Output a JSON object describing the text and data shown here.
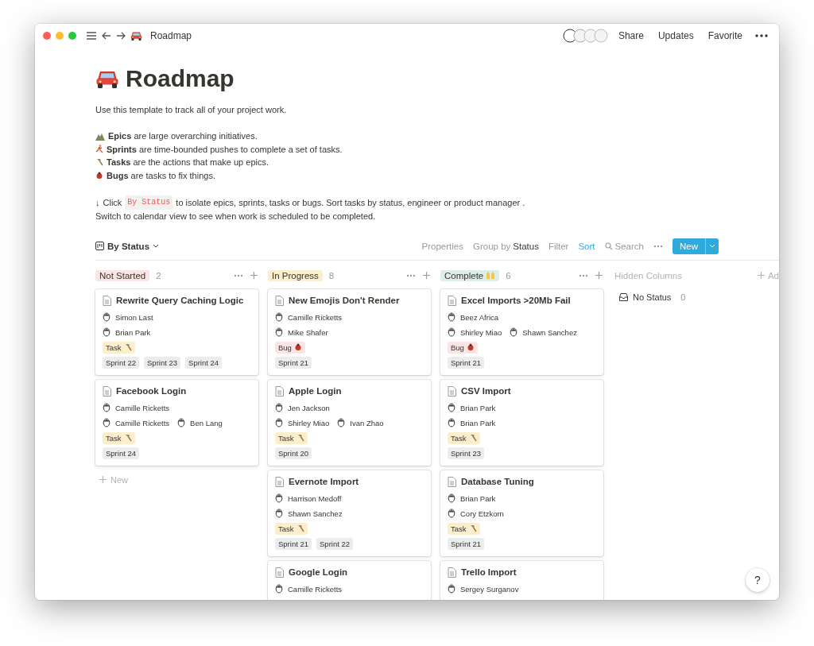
{
  "window": {
    "title": "Roadmap",
    "actions": [
      "Share",
      "Updates",
      "Favorite"
    ]
  },
  "page": {
    "title": "Roadmap",
    "intro": "Use this template to track all of your project work.",
    "definitions": [
      {
        "kind": "epic",
        "text": "**Epics** are large overarching initiatives."
      },
      {
        "kind": "sprint",
        "text": "**Sprints** are time-bounded pushes to complete a set of tasks."
      },
      {
        "kind": "task",
        "text": "**Tasks** are the actions that make up epics."
      },
      {
        "kind": "bug",
        "text": "**Bugs** are tasks to fix things."
      }
    ],
    "hint": {
      "arrow": "↓",
      "before": "Click",
      "code": "By Status",
      "after": "to isolate epics, sprints, tasks or bugs. Sort tasks by status, engineer or product manager .",
      "line2": "Switch to calendar view to see when work is scheduled to be completed."
    }
  },
  "toolbar": {
    "view": "By Status",
    "properties": "Properties",
    "group_by": "Group by",
    "group_value": "Status",
    "filter": "Filter",
    "sort": {
      "label": "Sort",
      "active": true
    },
    "search": "Search",
    "new": "New"
  },
  "columns": [
    {
      "label": "Not Started",
      "color": "#fbe4e4",
      "count": "2",
      "new_label": "New",
      "cards": [
        {
          "title": "Rewrite Query Caching Logic",
          "people": [
            [
              "Simon Last"
            ],
            [
              "Brian Park"
            ]
          ],
          "tag": {
            "kind": "task",
            "label": "Task"
          },
          "sprints": [
            "Sprint 22",
            "Sprint 23",
            "Sprint 24"
          ]
        },
        {
          "title": "Facebook Login",
          "people": [
            [
              "Camille Ricketts"
            ],
            [
              "Camille Ricketts",
              "Ben Lang"
            ]
          ],
          "tag": {
            "kind": "task",
            "label": "Task"
          },
          "sprints": [
            "Sprint 24"
          ]
        }
      ]
    },
    {
      "label": "In Progress",
      "color": "#fbeecc",
      "count": "8",
      "cards": [
        {
          "title": "New Emojis Don't Render",
          "people": [
            [
              "Camille Ricketts"
            ],
            [
              "Mike Shafer"
            ]
          ],
          "tag": {
            "kind": "bug",
            "label": "Bug"
          },
          "sprints": [
            "Sprint 21"
          ]
        },
        {
          "title": "Apple Login",
          "people": [
            [
              "Jen Jackson"
            ],
            [
              "Shirley Miao",
              "Ivan Zhao"
            ]
          ],
          "tag": {
            "kind": "task",
            "label": "Task"
          },
          "sprints": [
            "Sprint 20"
          ]
        },
        {
          "title": "Evernote Import",
          "people": [
            [
              "Harrison Medoff"
            ],
            [
              "Shawn Sanchez"
            ]
          ],
          "tag": {
            "kind": "task",
            "label": "Task"
          },
          "sprints": [
            "Sprint 21",
            "Sprint 22"
          ]
        },
        {
          "title": "Google Login",
          "people": [
            [
              "Camille Ricketts"
            ]
          ]
        }
      ]
    },
    {
      "label": "Complete",
      "color": "#ddedea",
      "count": "6",
      "emoji": true,
      "cards": [
        {
          "title": "Excel Imports >20Mb Fail",
          "people": [
            [
              "Beez Africa"
            ],
            [
              "Shirley Miao",
              "Shawn Sanchez"
            ]
          ],
          "tag": {
            "kind": "bug",
            "label": "Bug"
          },
          "sprints": [
            "Sprint 21"
          ]
        },
        {
          "title": "CSV Import",
          "people": [
            [
              "Brian Park"
            ],
            [
              "Brian Park"
            ]
          ],
          "tag": {
            "kind": "task",
            "label": "Task"
          },
          "sprints": [
            "Sprint 23"
          ]
        },
        {
          "title": "Database Tuning",
          "people": [
            [
              "Brian Park"
            ],
            [
              "Cory Etzkorn"
            ]
          ],
          "tag": {
            "kind": "task",
            "label": "Task"
          },
          "sprints": [
            "Sprint 21"
          ]
        },
        {
          "title": "Trello Import",
          "people": [
            [
              "Sergey Surganov"
            ]
          ]
        }
      ]
    }
  ],
  "hidden": {
    "title": "Hidden Columns",
    "add": "Ad",
    "items": [
      {
        "label": "No Status",
        "count": "0"
      }
    ]
  },
  "help": "?"
}
